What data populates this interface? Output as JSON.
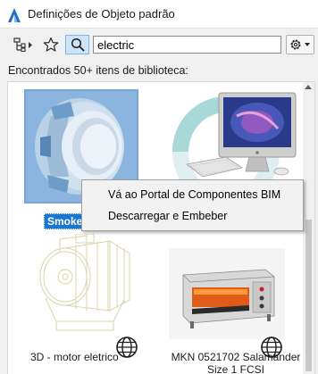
{
  "window": {
    "title": "Definições de Objeto padrão",
    "app_icon": "archicad-icon"
  },
  "toolbar": {
    "filter_icon": "filter-tree-icon",
    "favorites_icon": "star-icon",
    "search_icon": "search-icon",
    "search_value": "electric",
    "settings_icon": "gear-icon"
  },
  "results": {
    "found_text": "Encontrados 50+ itens de biblioteca:",
    "items": [
      {
        "label": "Smoke Det",
        "thumbnail": "smoke-detector-image",
        "selected": true
      },
      {
        "label": "",
        "thumbnail": "imac-computer-image",
        "selected": false
      },
      {
        "label": "3D - motor eletrico",
        "thumbnail": "electric-motor-image",
        "badge": "globe-icon"
      },
      {
        "label": "MKN 0521702 Salamander Size 1 FCSI",
        "thumbnail": "salamander-grill-image",
        "badge": "globe-icon"
      }
    ]
  },
  "context_menu": {
    "items": [
      {
        "label": "Vá ao Portal de Componentes BIM"
      },
      {
        "label": "Descarregar e Embeber"
      }
    ]
  },
  "colors": {
    "selection": "#1976d2",
    "search_active": "#cde3f7",
    "menu_bg": "#f2f2f2"
  }
}
